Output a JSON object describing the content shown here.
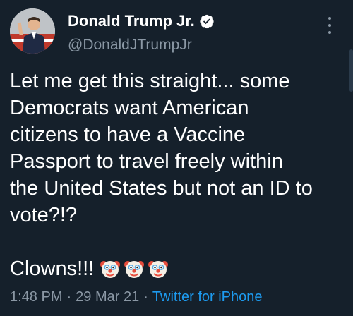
{
  "author": {
    "name": "Donald Trump Jr.",
    "handle": "@DonaldJTrumpJr",
    "verified_icon": "verified-badge-icon"
  },
  "tweet": {
    "text": "Let me get this straight... some\nDemocrats want American\ncitizens to have a Vaccine\nPassport to travel freely within\nthe United States but not an ID to\nvote?!?",
    "closing": "Clowns!!!",
    "emojis": [
      "clown-face-icon",
      "clown-face-icon",
      "clown-face-icon"
    ]
  },
  "meta": {
    "time": "1:48 PM",
    "separator": "·",
    "date": "29 Mar 21",
    "source": "Twitter for iPhone"
  },
  "colors": {
    "background": "#15202b",
    "text": "#ffffff",
    "secondary": "#8b98a5",
    "link": "#1d9bf0",
    "verified": "#ffffff"
  },
  "icons": {
    "more": "more-options-icon"
  }
}
